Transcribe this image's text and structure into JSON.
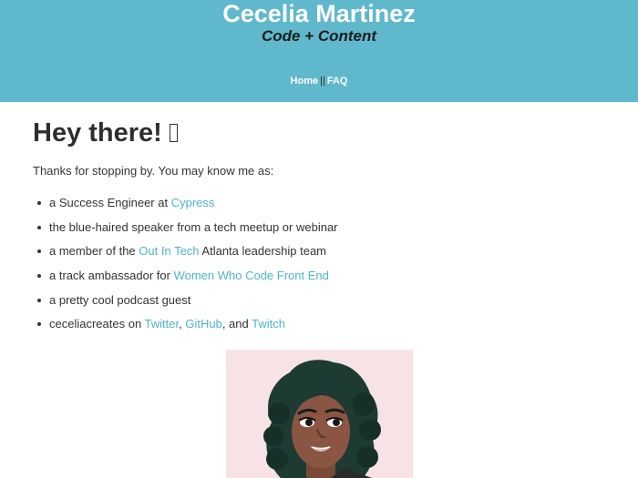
{
  "header": {
    "title": "Cecelia Martinez",
    "tagline": "Code + Content",
    "nav": {
      "home": "Home",
      "separator": "||",
      "faq": "FAQ"
    },
    "background_color": "#60b8cc"
  },
  "main": {
    "greeting": "Hey there!",
    "greeting_emoji": "wave-emoji-missing-glyph",
    "intro": "Thanks for stopping by. You may know me as:",
    "roles": [
      {
        "pre": "a Success Engineer at ",
        "link": "Cypress",
        "post": ""
      },
      {
        "pre": "the blue-haired speaker from a tech meetup or webinar",
        "link": "",
        "post": ""
      },
      {
        "pre": "a member of the ",
        "link": "Out In Tech",
        "post": " Atlanta leadership team"
      },
      {
        "pre": "a track ambassador for ",
        "link": "Women Who Code Front End",
        "post": ""
      },
      {
        "pre": "a pretty cool podcast guest",
        "link": "",
        "post": ""
      }
    ],
    "social": {
      "pre": "ceceliacreates on ",
      "twitter": "Twitter",
      "comma": ", ",
      "github": "GitHub",
      "and": ", and ",
      "twitch": "Twitch"
    },
    "link_color": "#4fb3c9",
    "avatar": {
      "icon": "avatar-illustration",
      "background_color": "#f7e3e5"
    }
  }
}
